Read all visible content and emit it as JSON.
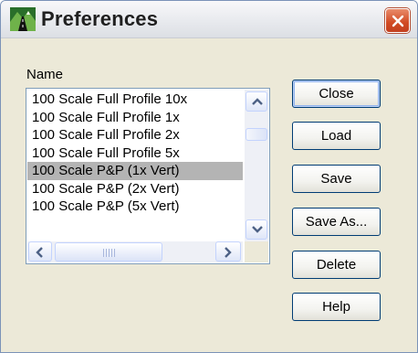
{
  "window": {
    "title": "Preferences",
    "close_icon": "close-icon"
  },
  "name_label": "Name",
  "list": {
    "items": [
      "100 Scale Full Profile 10x",
      "100 Scale Full Profile 1x",
      "100 Scale Full Profile 2x",
      "100 Scale Full Profile 5x",
      "100 Scale P&P (1x Vert)",
      "100 Scale P&P (2x Vert)",
      "100 Scale P&P (5x Vert)"
    ],
    "selected_index": 4
  },
  "buttons": {
    "close": "Close",
    "load": "Load",
    "save": "Save",
    "save_as": "Save As...",
    "delete": "Delete",
    "help": "Help"
  },
  "colors": {
    "selection": "#b4b4b4",
    "title_close": "#d14a23",
    "face": "#ece9d8"
  }
}
